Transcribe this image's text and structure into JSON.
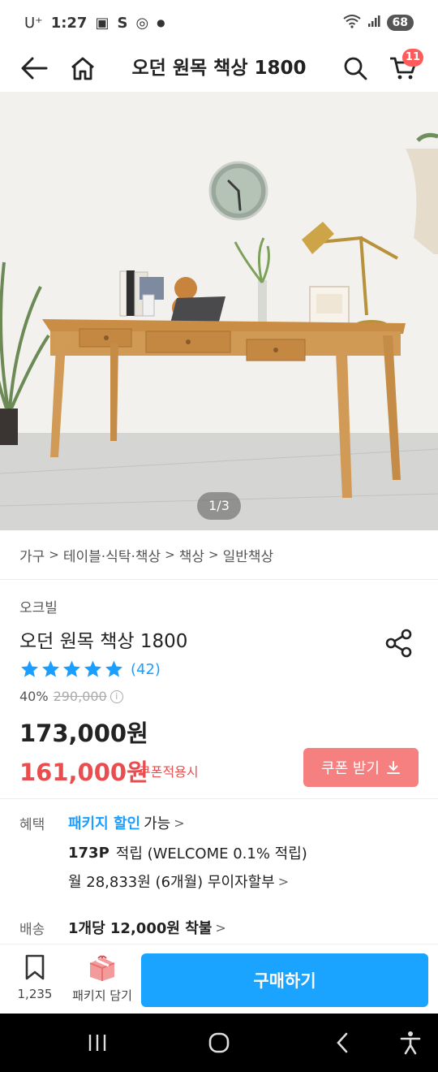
{
  "status_bar": {
    "carrier": "U⁺",
    "time": "1:27",
    "battery": "68"
  },
  "header": {
    "title": "오던 원목 책상 1800",
    "cart_count": "11"
  },
  "gallery": {
    "counter": "1/3"
  },
  "breadcrumb": [
    "가구",
    "테이블·식탁·책상",
    "책상",
    "일반책상"
  ],
  "product": {
    "brand": "오크빌",
    "title": "오던 원목 책상 1800",
    "rating_stars": 5,
    "review_count": "(42)",
    "discount": "40%",
    "original_price": "290,000",
    "price": "173,000원",
    "coupon_price": "161,000원",
    "coupon_note": "쿠폰적용시",
    "coupon_button": "쿠폰 받기"
  },
  "benefits": {
    "label": "혜택",
    "package_link": "패키지 할인",
    "package_suffix": "가능",
    "points_value": "173P",
    "points_text": "적립 (WELCOME 0.1% 적립)",
    "installment": "월 28,833원 (6개월) 무이자할부"
  },
  "shipping": {
    "label": "배송",
    "text": "1개당 12,000원 착불"
  },
  "action_bar": {
    "scrap_count": "1,235",
    "package_label": "패키지 담기",
    "buy_label": "구매하기"
  },
  "colors": {
    "accent": "#1aa3ff",
    "sale": "#ea4d4d",
    "coupon_btn": "#f67f7f",
    "star": "#1a9eff"
  }
}
